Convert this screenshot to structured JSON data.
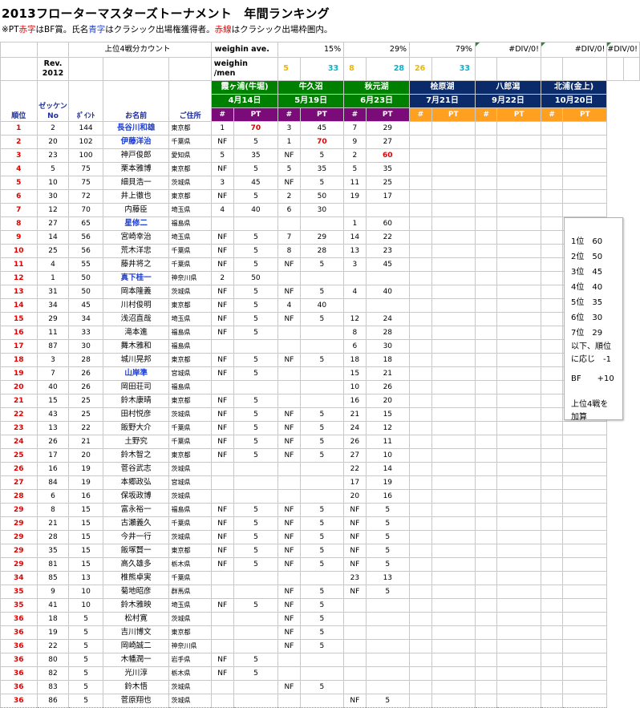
{
  "title": "2013フローターマスターズトーナメント　年間ランキング",
  "note": {
    "p1": "※PT",
    "p2": "赤字",
    "p3": "はBF賞。氏名",
    "p4": "青字",
    "p5": "はクラシック出場権獲得者。",
    "p6": "赤線",
    "p7": "はクラシック出場枠圏内。"
  },
  "meta": {
    "top4_label": "上位4戦分カウント",
    "ave_label": "weighin ave.",
    "ave_values": [
      "15%",
      "29%",
      "79%"
    ],
    "div0": "#DIV/0!",
    "rev": "Rev.\n2012",
    "weighin_men_label": "weighin\n/men",
    "men_values": [
      {
        "a": "5",
        "b": "33",
        "ca": "#f0b400",
        "cb": "#00b4d0"
      },
      {
        "a": "8",
        "b": "28",
        "ca": "#f0b400",
        "cb": "#00b4d0"
      },
      {
        "a": "26",
        "b": "33",
        "ca": "#f0b400",
        "cb": "#00b4d0"
      }
    ]
  },
  "headers": {
    "rank": "順位",
    "zekken": "ゼッケン\nNo",
    "point": "ﾎﾟｲﾝﾄ",
    "name": "お名前",
    "address": "ご住所",
    "hash": "#",
    "pt": "PT"
  },
  "venues": [
    {
      "name": "霞ヶ浦(牛堀)",
      "date": "4月14日",
      "color": "#008000"
    },
    {
      "name": "牛久沼",
      "date": "5月19日",
      "color": "#008000"
    },
    {
      "name": "秋元湖",
      "date": "6月23日",
      "color": "#008000"
    },
    {
      "name": "桧原湖",
      "date": "7月21日",
      "color": "#0a2a6a"
    },
    {
      "name": "八郎潟",
      "date": "9月22日",
      "color": "#0a2a6a"
    },
    {
      "name": "北浦(金上)",
      "date": "10月20日",
      "color": "#0a2a6a"
    }
  ],
  "rows": [
    {
      "rank": "1",
      "no": "2",
      "pt": "144",
      "name": "長谷川和雄",
      "blue": true,
      "pref": "東京都",
      "r": [
        [
          "1",
          "70"
        ],
        [
          "3",
          "45"
        ],
        [
          "7",
          "29"
        ]
      ],
      "red": [
        0
      ]
    },
    {
      "rank": "2",
      "no": "20",
      "pt": "102",
      "name": "伊藤洋治",
      "blue": true,
      "pref": "千葉県",
      "r": [
        [
          "NF",
          "5"
        ],
        [
          "1",
          "70"
        ],
        [
          "9",
          "27"
        ]
      ],
      "red": [
        1
      ]
    },
    {
      "rank": "3",
      "no": "23",
      "pt": "100",
      "name": "神戸俊郎",
      "blue": false,
      "pref": "愛知県",
      "r": [
        [
          "5",
          "35"
        ],
        [
          "NF",
          "5"
        ],
        [
          "2",
          "60"
        ]
      ],
      "red": [
        2
      ]
    },
    {
      "rank": "4",
      "no": "5",
      "pt": "75",
      "name": "栗本雅博",
      "blue": false,
      "pref": "東京都",
      "r": [
        [
          "NF",
          "5"
        ],
        [
          "5",
          "35"
        ],
        [
          "5",
          "35"
        ]
      ],
      "red": []
    },
    {
      "rank": "5",
      "no": "10",
      "pt": "75",
      "name": "細貝浩一",
      "blue": false,
      "pref": "茨城県",
      "r": [
        [
          "3",
          "45"
        ],
        [
          "NF",
          "5"
        ],
        [
          "11",
          "25"
        ]
      ],
      "red": []
    },
    {
      "rank": "6",
      "no": "30",
      "pt": "72",
      "name": "井上徹也",
      "blue": false,
      "pref": "東京都",
      "r": [
        [
          "NF",
          "5"
        ],
        [
          "2",
          "50"
        ],
        [
          "19",
          "17"
        ]
      ],
      "red": []
    },
    {
      "rank": "7",
      "no": "12",
      "pt": "70",
      "name": "内藤臣",
      "blue": false,
      "pref": "埼玉県",
      "r": [
        [
          "4",
          "40"
        ],
        [
          "6",
          "30"
        ],
        [
          "",
          ""
        ]
      ],
      "red": []
    },
    {
      "rank": "8",
      "no": "27",
      "pt": "65",
      "name": "星修二",
      "blue": true,
      "pref": "福島県",
      "r": [
        [
          "",
          ""
        ],
        [
          "",
          ""
        ],
        [
          "1",
          "60"
        ]
      ],
      "red": []
    },
    {
      "rank": "9",
      "no": "14",
      "pt": "56",
      "name": "宮崎幸治",
      "blue": false,
      "pref": "埼玉県",
      "r": [
        [
          "NF",
          "5"
        ],
        [
          "7",
          "29"
        ],
        [
          "14",
          "22"
        ]
      ],
      "red": []
    },
    {
      "rank": "10",
      "no": "25",
      "pt": "56",
      "name": "荒木洋忠",
      "blue": false,
      "pref": "千葉県",
      "r": [
        [
          "NF",
          "5"
        ],
        [
          "8",
          "28"
        ],
        [
          "13",
          "23"
        ]
      ],
      "red": []
    },
    {
      "rank": "11",
      "no": "4",
      "pt": "55",
      "name": "藤井将之",
      "blue": false,
      "pref": "千葉県",
      "r": [
        [
          "NF",
          "5"
        ],
        [
          "NF",
          "5"
        ],
        [
          "3",
          "45"
        ]
      ],
      "red": []
    },
    {
      "rank": "12",
      "no": "1",
      "pt": "50",
      "name": "真下桂一",
      "blue": true,
      "pref": "神奈川県",
      "r": [
        [
          "2",
          "50"
        ],
        [
          "",
          ""
        ],
        [
          "",
          ""
        ]
      ],
      "red": []
    },
    {
      "rank": "13",
      "no": "31",
      "pt": "50",
      "name": "岡本隆義",
      "blue": false,
      "pref": "茨城県",
      "r": [
        [
          "NF",
          "5"
        ],
        [
          "NF",
          "5"
        ],
        [
          "4",
          "40"
        ]
      ],
      "red": []
    },
    {
      "rank": "14",
      "no": "34",
      "pt": "45",
      "name": "川村俊明",
      "blue": false,
      "pref": "東京都",
      "r": [
        [
          "NF",
          "5"
        ],
        [
          "4",
          "40"
        ],
        [
          "",
          ""
        ]
      ],
      "red": []
    },
    {
      "rank": "15",
      "no": "29",
      "pt": "34",
      "name": "浅沼直哉",
      "blue": false,
      "pref": "埼玉県",
      "r": [
        [
          "NF",
          "5"
        ],
        [
          "NF",
          "5"
        ],
        [
          "12",
          "24"
        ]
      ],
      "red": []
    },
    {
      "rank": "16",
      "no": "11",
      "pt": "33",
      "name": "滝本進",
      "blue": false,
      "pref": "福島県",
      "r": [
        [
          "NF",
          "5"
        ],
        [
          "",
          ""
        ],
        [
          "8",
          "28"
        ]
      ],
      "red": []
    },
    {
      "rank": "17",
      "no": "87",
      "pt": "30",
      "name": "舞木雅和",
      "blue": false,
      "pref": "福島県",
      "r": [
        [
          "",
          ""
        ],
        [
          "",
          ""
        ],
        [
          "6",
          "30"
        ]
      ],
      "red": []
    },
    {
      "rank": "18",
      "no": "3",
      "pt": "28",
      "name": "城川晃邦",
      "blue": false,
      "pref": "東京都",
      "r": [
        [
          "NF",
          "5"
        ],
        [
          "NF",
          "5"
        ],
        [
          "18",
          "18"
        ]
      ],
      "red": []
    },
    {
      "rank": "19",
      "no": "7",
      "pt": "26",
      "name": "山岸準",
      "blue": true,
      "pref": "宮城県",
      "r": [
        [
          "NF",
          "5"
        ],
        [
          "",
          ""
        ],
        [
          "15",
          "21"
        ]
      ],
      "red": []
    },
    {
      "rank": "20",
      "no": "40",
      "pt": "26",
      "name": "岡田荘司",
      "blue": false,
      "pref": "福島県",
      "r": [
        [
          "",
          ""
        ],
        [
          "",
          ""
        ],
        [
          "10",
          "26"
        ]
      ],
      "red": []
    },
    {
      "rank": "21",
      "no": "15",
      "pt": "25",
      "name": "鈴木康晴",
      "blue": false,
      "pref": "東京都",
      "r": [
        [
          "NF",
          "5"
        ],
        [
          "",
          ""
        ],
        [
          "16",
          "20"
        ]
      ],
      "red": []
    },
    {
      "rank": "22",
      "no": "43",
      "pt": "25",
      "name": "田村悦彦",
      "blue": false,
      "pref": "茨城県",
      "r": [
        [
          "NF",
          "5"
        ],
        [
          "NF",
          "5"
        ],
        [
          "21",
          "15"
        ]
      ],
      "red": []
    },
    {
      "rank": "23",
      "no": "13",
      "pt": "22",
      "name": "飯野大介",
      "blue": false,
      "pref": "千葉県",
      "r": [
        [
          "NF",
          "5"
        ],
        [
          "NF",
          "5"
        ],
        [
          "24",
          "12"
        ]
      ],
      "red": []
    },
    {
      "rank": "24",
      "no": "26",
      "pt": "21",
      "name": "土野究",
      "blue": false,
      "pref": "千葉県",
      "r": [
        [
          "NF",
          "5"
        ],
        [
          "NF",
          "5"
        ],
        [
          "26",
          "11"
        ]
      ],
      "red": []
    },
    {
      "rank": "25",
      "no": "17",
      "pt": "20",
      "name": "鈴木智之",
      "blue": false,
      "pref": "東京都",
      "r": [
        [
          "NF",
          "5"
        ],
        [
          "NF",
          "5"
        ],
        [
          "27",
          "10"
        ]
      ],
      "red": []
    },
    {
      "rank": "26",
      "no": "16",
      "pt": "19",
      "name": "菅谷武志",
      "blue": false,
      "pref": "茨城県",
      "r": [
        [
          "",
          ""
        ],
        [
          "",
          ""
        ],
        [
          "22",
          "14"
        ]
      ],
      "red": []
    },
    {
      "rank": "27",
      "no": "84",
      "pt": "19",
      "name": "本郷政弘",
      "blue": false,
      "pref": "宮城県",
      "r": [
        [
          "",
          ""
        ],
        [
          "",
          ""
        ],
        [
          "17",
          "19"
        ]
      ],
      "red": []
    },
    {
      "rank": "28",
      "no": "6",
      "pt": "16",
      "name": "保坂政博",
      "blue": false,
      "pref": "茨城県",
      "r": [
        [
          "",
          ""
        ],
        [
          "",
          ""
        ],
        [
          "20",
          "16"
        ]
      ],
      "red": []
    },
    {
      "rank": "29",
      "no": "8",
      "pt": "15",
      "name": "富永裕一",
      "blue": false,
      "pref": "福島県",
      "r": [
        [
          "NF",
          "5"
        ],
        [
          "NF",
          "5"
        ],
        [
          "NF",
          "5"
        ]
      ],
      "red": []
    },
    {
      "rank": "29",
      "no": "21",
      "pt": "15",
      "name": "古瀬義久",
      "blue": false,
      "pref": "千葉県",
      "r": [
        [
          "NF",
          "5"
        ],
        [
          "NF",
          "5"
        ],
        [
          "NF",
          "5"
        ]
      ],
      "red": []
    },
    {
      "rank": "29",
      "no": "28",
      "pt": "15",
      "name": "今井一行",
      "blue": false,
      "pref": "茨城県",
      "r": [
        [
          "NF",
          "5"
        ],
        [
          "NF",
          "5"
        ],
        [
          "NF",
          "5"
        ]
      ],
      "red": []
    },
    {
      "rank": "29",
      "no": "35",
      "pt": "15",
      "name": "飯塚賢一",
      "blue": false,
      "pref": "東京都",
      "r": [
        [
          "NF",
          "5"
        ],
        [
          "NF",
          "5"
        ],
        [
          "NF",
          "5"
        ]
      ],
      "red": []
    },
    {
      "rank": "29",
      "no": "81",
      "pt": "15",
      "name": "高久雄多",
      "blue": false,
      "pref": "栃木県",
      "r": [
        [
          "NF",
          "5"
        ],
        [
          "NF",
          "5"
        ],
        [
          "NF",
          "5"
        ]
      ],
      "red": []
    },
    {
      "rank": "34",
      "no": "85",
      "pt": "13",
      "name": "椎熊卓実",
      "blue": false,
      "pref": "千葉県",
      "r": [
        [
          "",
          ""
        ],
        [
          "",
          ""
        ],
        [
          "23",
          "13"
        ]
      ],
      "red": []
    },
    {
      "rank": "35",
      "no": "9",
      "pt": "10",
      "name": "菊地昭彦",
      "blue": false,
      "pref": "群馬県",
      "r": [
        [
          "",
          ""
        ],
        [
          "NF",
          "5"
        ],
        [
          "NF",
          "5"
        ]
      ],
      "red": []
    },
    {
      "rank": "35",
      "no": "41",
      "pt": "10",
      "name": "鈴木雅映",
      "blue": false,
      "pref": "埼玉県",
      "r": [
        [
          "NF",
          "5"
        ],
        [
          "NF",
          "5"
        ],
        [
          "",
          ""
        ]
      ],
      "red": []
    },
    {
      "rank": "36",
      "no": "18",
      "pt": "5",
      "name": "松村寛",
      "blue": false,
      "pref": "茨城県",
      "r": [
        [
          "",
          ""
        ],
        [
          "NF",
          "5"
        ],
        [
          "",
          ""
        ]
      ],
      "red": []
    },
    {
      "rank": "36",
      "no": "19",
      "pt": "5",
      "name": "吉川博文",
      "blue": false,
      "pref": "東京都",
      "r": [
        [
          "",
          ""
        ],
        [
          "NF",
          "5"
        ],
        [
          "",
          ""
        ]
      ],
      "red": []
    },
    {
      "rank": "36",
      "no": "22",
      "pt": "5",
      "name": "岡崎誠二",
      "blue": false,
      "pref": "神奈川県",
      "r": [
        [
          "",
          ""
        ],
        [
          "NF",
          "5"
        ],
        [
          "",
          ""
        ]
      ],
      "red": []
    },
    {
      "rank": "36",
      "no": "80",
      "pt": "5",
      "name": "木幡潤一",
      "blue": false,
      "pref": "岩手県",
      "r": [
        [
          "NF",
          "5"
        ],
        [
          "",
          ""
        ],
        [
          "",
          ""
        ]
      ],
      "red": []
    },
    {
      "rank": "36",
      "no": "82",
      "pt": "5",
      "name": "光川淳",
      "blue": false,
      "pref": "栃木県",
      "r": [
        [
          "NF",
          "5"
        ],
        [
          "",
          ""
        ],
        [
          "",
          ""
        ]
      ],
      "red": []
    },
    {
      "rank": "36",
      "no": "83",
      "pt": "5",
      "name": "鈴木悟",
      "blue": false,
      "pref": "茨城県",
      "r": [
        [
          "",
          ""
        ],
        [
          "NF",
          "5"
        ],
        [
          "",
          ""
        ]
      ],
      "red": []
    },
    {
      "rank": "36",
      "no": "86",
      "pt": "5",
      "name": "菅原翔也",
      "blue": false,
      "pref": "茨城県",
      "r": [
        [
          "",
          ""
        ],
        [
          "",
          ""
        ],
        [
          "NF",
          "5"
        ]
      ],
      "red": []
    }
  ],
  "popup": {
    "lines": [
      "1位　60",
      "2位　50",
      "3位　45",
      "4位　40",
      "5位　35",
      "6位　30",
      "7位　29"
    ],
    "extra": [
      "以下、順位",
      "に応じ　-1"
    ],
    "bf": "BF　　+10",
    "footer": [
      "上位4戦を",
      "加算"
    ]
  }
}
